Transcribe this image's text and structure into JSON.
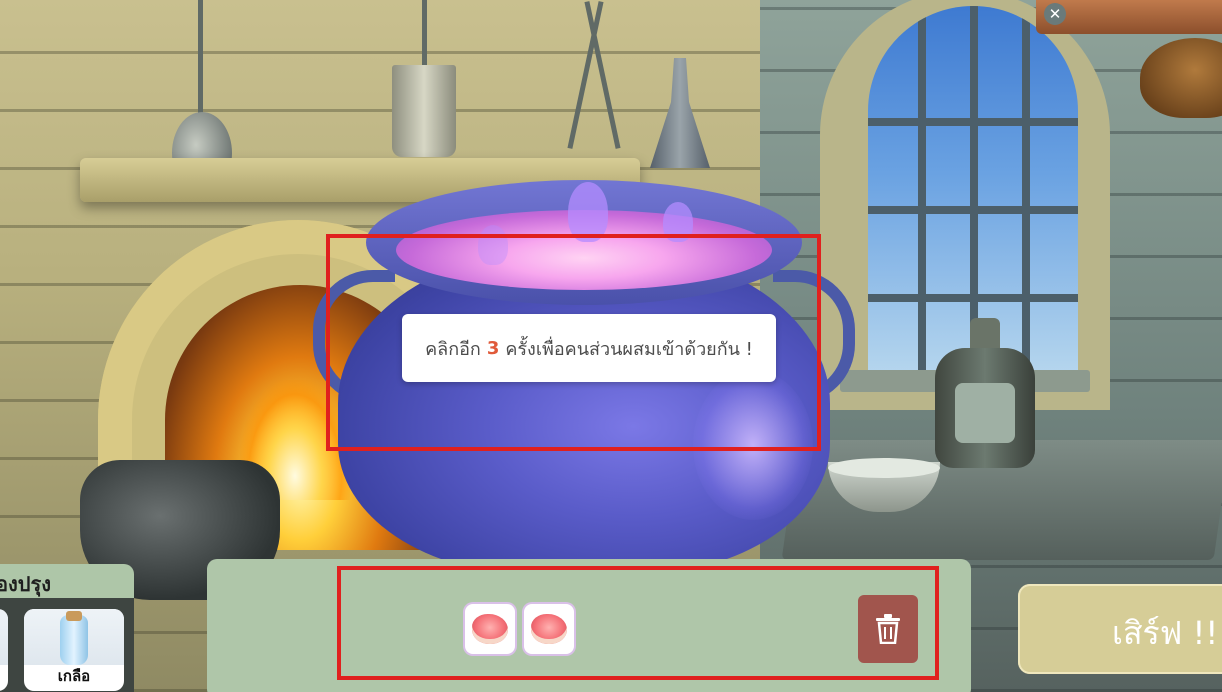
{
  "game": {
    "instruction": {
      "prefix": "คลิกอีก",
      "clicks_remaining": "3",
      "suffix": "ครั้งเพื่อคนส่วนผสมเข้าด้วยกัน !"
    },
    "recipe_panel": {
      "title": "องปรุง",
      "ingredients": [
        {
          "label": "เกลือ",
          "icon": "salt-bottle-icon"
        }
      ]
    },
    "mix_tray": {
      "items": [
        {
          "icon": "meat-icon"
        },
        {
          "icon": "meat-icon"
        }
      ]
    },
    "buttons": {
      "serve": "เสิร์ฟ !!",
      "trash_icon": "trash-icon",
      "close_icon": "close-icon"
    },
    "colors": {
      "highlight": "#e0201e",
      "panel": "#afc6a9",
      "trash": "#a1554d",
      "serve": "#d6cd97",
      "number": "#e05a3a"
    }
  }
}
